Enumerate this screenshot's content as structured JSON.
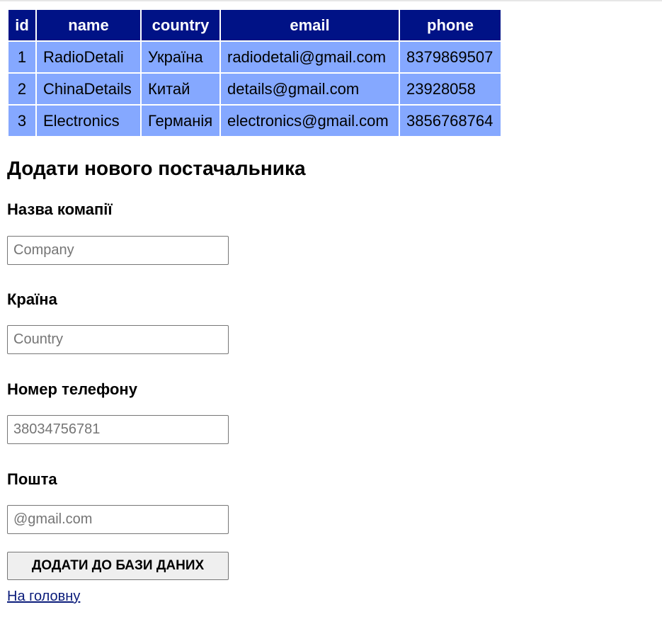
{
  "table": {
    "headers": [
      "id",
      "name",
      "country",
      "email",
      "phone"
    ],
    "rows": [
      [
        "1",
        "RadioDetali",
        "Україна",
        "radiodetali@gmail.com",
        "8379869507"
      ],
      [
        "2",
        "ChinaDetails",
        "Китай",
        "details@gmail.com",
        "23928058"
      ],
      [
        "3",
        "Electronics",
        "Германія",
        "electronics@gmail.com",
        "3856768764"
      ]
    ]
  },
  "form": {
    "title": "Додати нового постачальника",
    "company": {
      "label": "Назва комапії",
      "placeholder": "Company",
      "value": ""
    },
    "country": {
      "label": "Країна",
      "placeholder": "Country",
      "value": ""
    },
    "phone": {
      "label": "Номер телефону",
      "placeholder": "38034756781",
      "value": ""
    },
    "email": {
      "label": "Пошта",
      "placeholder": "@gmail.com",
      "value": ""
    },
    "submit_label": "ДОДАТИ ДО БАЗИ ДАНИХ"
  },
  "links": {
    "home": "На головну"
  },
  "colors": {
    "header_bg": "#001286",
    "cell_bg": "#85a8ff"
  }
}
